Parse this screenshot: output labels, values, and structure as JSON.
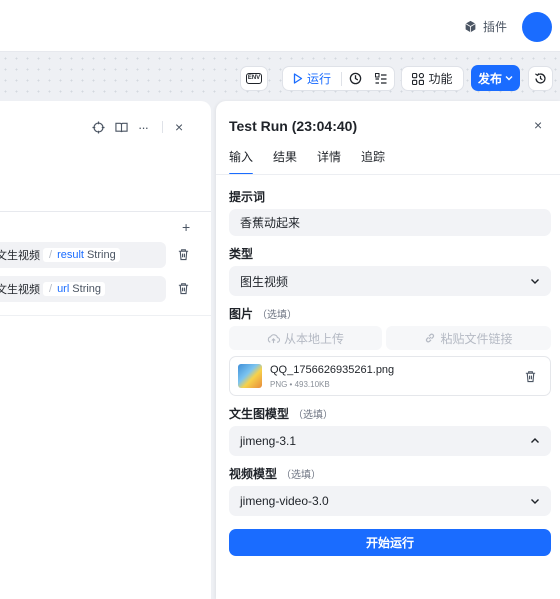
{
  "header": {
    "plugin_label": "插件",
    "icons": [
      "cube-icon",
      "avatar"
    ]
  },
  "toolbar": {
    "env_label": "ENV",
    "run_label": "运行",
    "feature_label": "功能",
    "publish_label": "发布",
    "icons": [
      "play-icon",
      "clock-icon",
      "list-check-icon",
      "grid-icon",
      "chevron-down-icon",
      "history-icon"
    ]
  },
  "left_panel": {
    "tool_icons": [
      "crosshair-icon",
      "book-icon",
      "more-icon",
      "close-icon"
    ],
    "add_label": "+",
    "vars": [
      {
        "prefix": "文生视频",
        "name": "result",
        "type": "String"
      },
      {
        "prefix": "文生视频",
        "name": "url",
        "type": "String"
      }
    ]
  },
  "test_run": {
    "title": "Test Run (23:04:40)",
    "close_label": "×",
    "tabs": [
      {
        "label": "输入",
        "active": true
      },
      {
        "label": "结果",
        "active": false
      },
      {
        "label": "详情",
        "active": false
      },
      {
        "label": "追踪",
        "active": false
      }
    ],
    "prompt_label": "提示词",
    "prompt_value": "香蕉动起来",
    "type_label": "类型",
    "type_value": "图生视频",
    "image_label": "图片",
    "optional": "（选填）",
    "upload_local": "从本地上传",
    "paste_link": "粘贴文件链接",
    "file_name": "QQ_1756626935261.png",
    "file_meta": "PNG • 493.10KB",
    "t2i_model_label": "文生图模型",
    "t2i_model_value": "jimeng-3.1",
    "video_model_label": "视频模型",
    "video_model_value": "jimeng-video-3.0",
    "start_label": "开始运行"
  },
  "colors": {
    "accent": "#1a6cff",
    "field_bg": "#f2f3f6",
    "canvas_bg": "#eef0f4"
  }
}
